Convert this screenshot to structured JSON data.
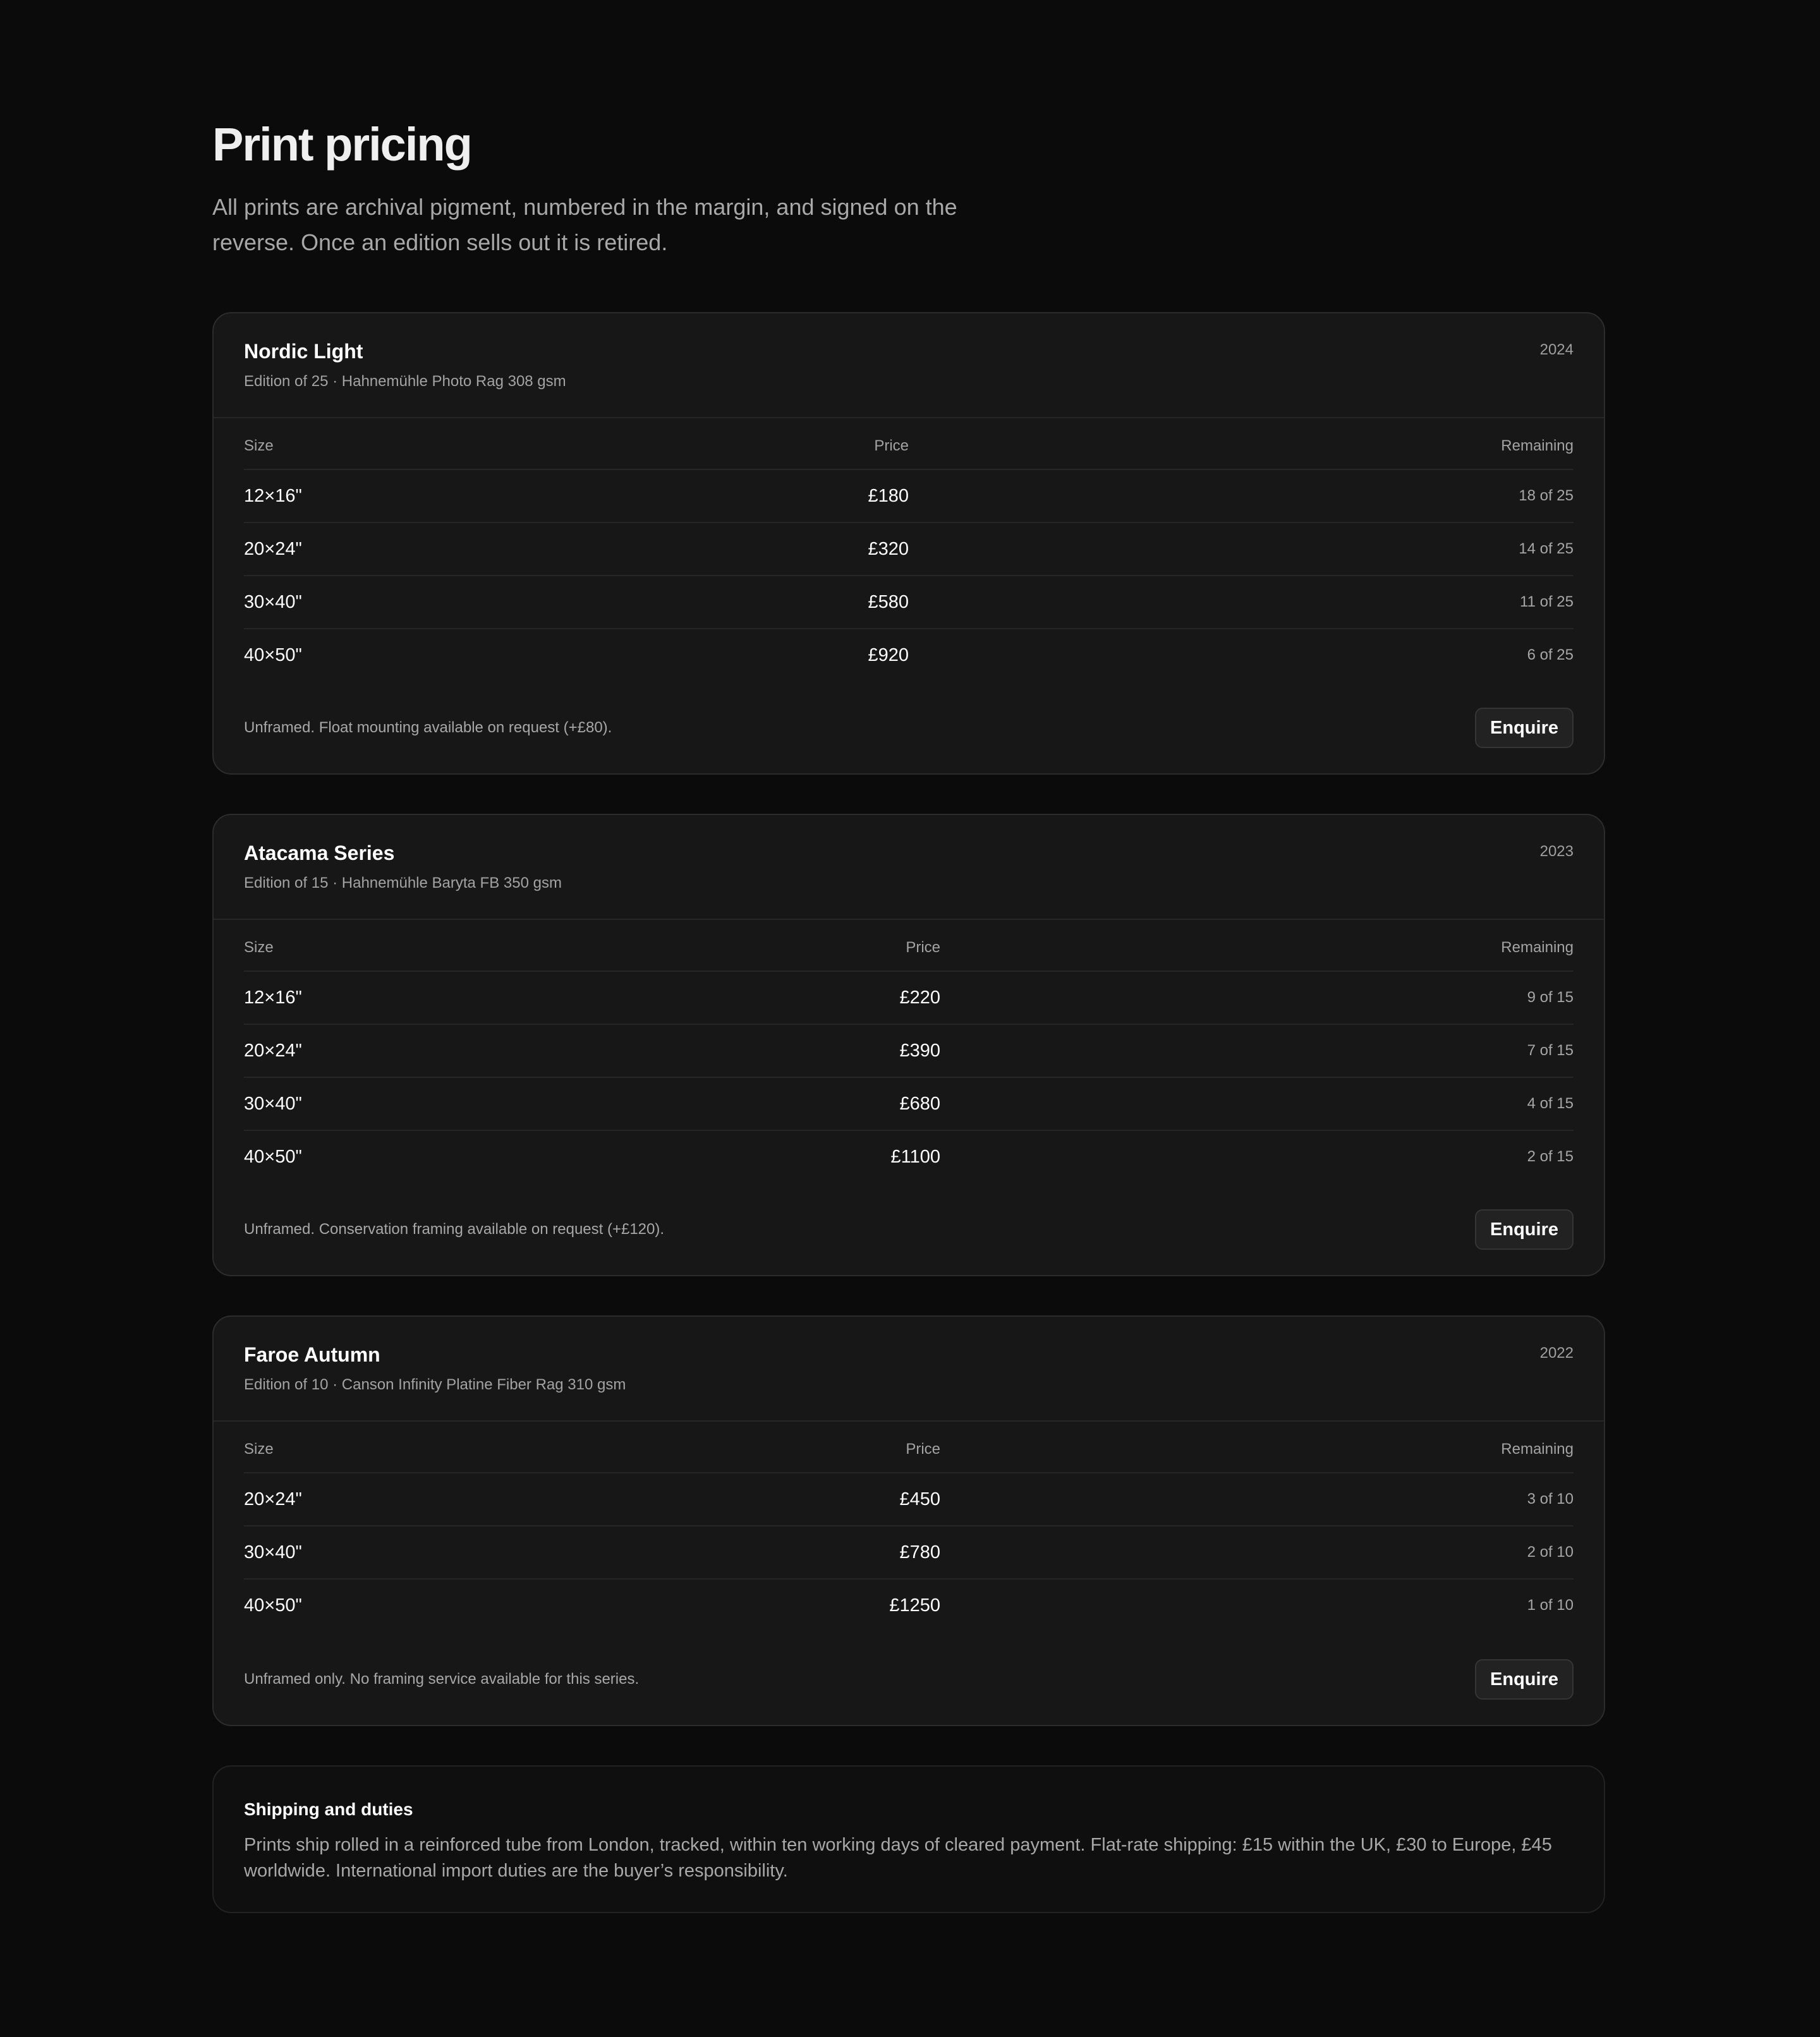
{
  "page": {
    "title": "Print pricing",
    "subtitle": "All prints are archival pigment, numbered in the margin, and signed on the reverse. Once an edition sells out it is retired."
  },
  "headers": {
    "size": "Size",
    "price": "Price",
    "remaining": "Remaining"
  },
  "cards": [
    {
      "name": "Nordic Light",
      "meta": "Edition of 25 · Hahnemühle Photo Rag 308 gsm",
      "year": "2024",
      "rows": [
        {
          "size": "12×16\"",
          "price": "£180",
          "remaining": "18 of 25"
        },
        {
          "size": "20×24\"",
          "price": "£320",
          "remaining": "14 of 25"
        },
        {
          "size": "30×40\"",
          "price": "£580",
          "remaining": "11 of 25"
        },
        {
          "size": "40×50\"",
          "price": "£920",
          "remaining": "6 of 25"
        }
      ],
      "note": "Unframed. Float mounting available on request (+£80).",
      "button": "Enquire"
    },
    {
      "name": "Atacama Series",
      "meta": "Edition of 15 · Hahnemühle Baryta FB 350 gsm",
      "year": "2023",
      "rows": [
        {
          "size": "12×16\"",
          "price": "£220",
          "remaining": "9 of 15"
        },
        {
          "size": "20×24\"",
          "price": "£390",
          "remaining": "7 of 15"
        },
        {
          "size": "30×40\"",
          "price": "£680",
          "remaining": "4 of 15"
        },
        {
          "size": "40×50\"",
          "price": "£1100",
          "remaining": "2 of 15"
        }
      ],
      "note": "Unframed. Conservation framing available on request (+£120).",
      "button": "Enquire"
    },
    {
      "name": "Faroe Autumn",
      "meta": "Edition of 10 · Canson Infinity Platine Fiber Rag 310 gsm",
      "year": "2022",
      "rows": [
        {
          "size": "20×24\"",
          "price": "£450",
          "remaining": "3 of 10"
        },
        {
          "size": "30×40\"",
          "price": "£780",
          "remaining": "2 of 10"
        },
        {
          "size": "40×50\"",
          "price": "£1250",
          "remaining": "1 of 10"
        }
      ],
      "note": "Unframed only. No framing service available for this series.",
      "button": "Enquire"
    }
  ],
  "shipping": {
    "title": "Shipping and duties",
    "body": "Prints ship rolled in a reinforced tube from London, tracked, within ten working days of cleared payment. Flat-rate shipping: £15 within the UK, £30 to Europe, £45 worldwide. International import duties are the buyer’s responsibility."
  }
}
